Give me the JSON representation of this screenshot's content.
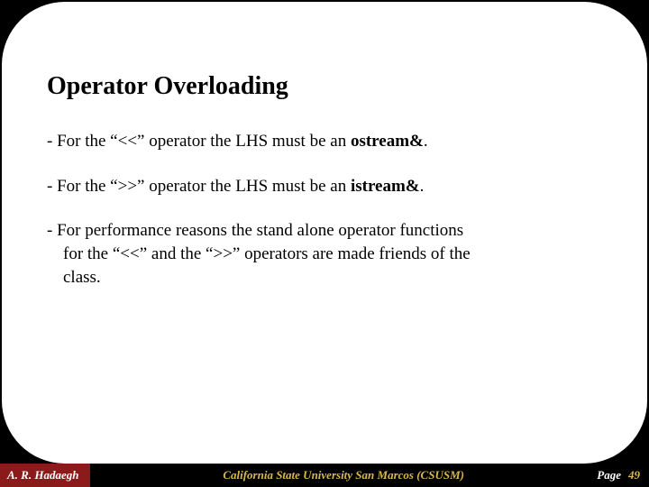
{
  "title": "Operator Overloading",
  "bullets": {
    "b1_pre": "-  For the “<<” operator the LHS must be an ",
    "b1_bold": "ostream&",
    "b1_post": ".",
    "b2_pre": "- For the “>>” operator the LHS must be an ",
    "b2_bold": "istream&",
    "b2_post": ".",
    "b3_line1": "- For performance reasons the stand alone operator functions",
    "b3_line2": "for the “<<” and the “>>” operators are made friends of the",
    "b3_line3": "class."
  },
  "footer": {
    "author": "A. R. Hadaegh",
    "center": "California State University San Marcos (CSUSM)",
    "page_label": "Page",
    "page_num": "49"
  }
}
